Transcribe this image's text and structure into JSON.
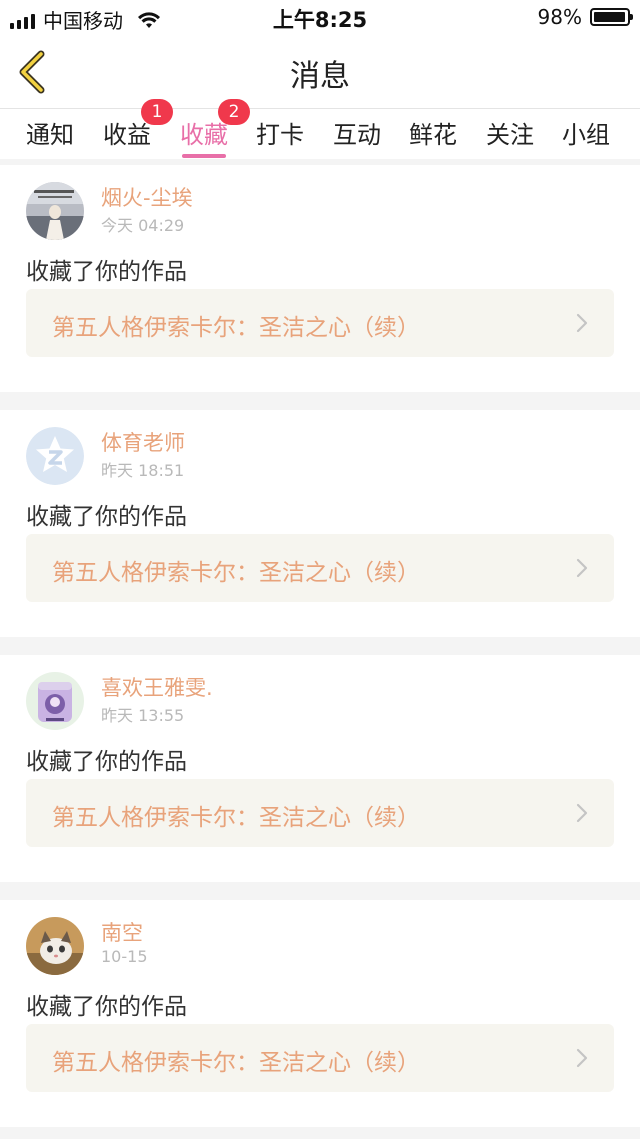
{
  "status_bar": {
    "carrier": "中国移动",
    "time": "上午8:25",
    "battery": "98%",
    "battery_level": 0.98
  },
  "nav": {
    "title": "消息",
    "back_icon": "chevron-left-icon"
  },
  "tabs": [
    {
      "label": "通知",
      "badge": null,
      "active": false
    },
    {
      "label": "收益",
      "badge": "1",
      "active": false
    },
    {
      "label": "收藏",
      "badge": "2",
      "active": true
    },
    {
      "label": "打卡",
      "badge": null,
      "active": false
    },
    {
      "label": "互动",
      "badge": null,
      "active": false
    },
    {
      "label": "鲜花",
      "badge": null,
      "active": false
    },
    {
      "label": "关注",
      "badge": null,
      "active": false
    },
    {
      "label": "小组",
      "badge": null,
      "active": false
    }
  ],
  "messages": [
    {
      "user": "烟火-尘埃",
      "time": "今天 04:29",
      "action": "收藏了你的作品",
      "work": "第五人格伊索卡尔：圣洁之心（续）"
    },
    {
      "user": "体育老师",
      "time": "昨天 18:51",
      "action": "收藏了你的作品",
      "work": "第五人格伊索卡尔：圣洁之心（续）"
    },
    {
      "user": "喜欢王雅雯.",
      "time": "昨天 13:55",
      "action": "收藏了你的作品",
      "work": "第五人格伊索卡尔：圣洁之心（续）"
    },
    {
      "user": "南空",
      "time": "10-15",
      "action": "收藏了你的作品",
      "work": "第五人格伊索卡尔：圣洁之心（续）"
    }
  ],
  "colors": {
    "accent": "#e86fa8",
    "badge": "#f0384c",
    "username": "#e8a37b",
    "link_bg": "#f6f5ef"
  }
}
